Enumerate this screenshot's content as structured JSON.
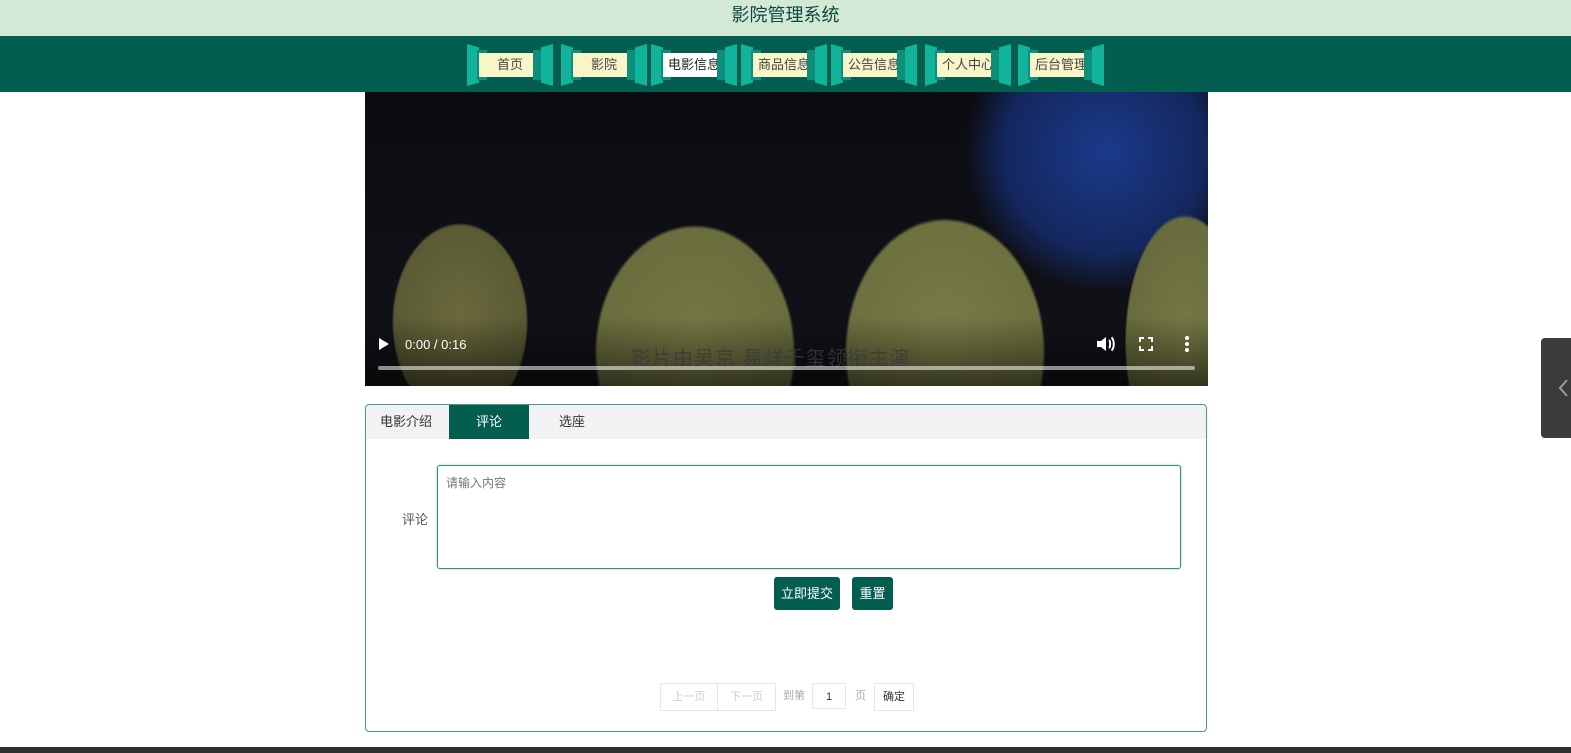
{
  "header": {
    "title": "影院管理系统"
  },
  "nav": {
    "items": [
      {
        "label": "首页",
        "active": false
      },
      {
        "label": "影院",
        "active": false
      },
      {
        "label": "电影信息",
        "active": true
      },
      {
        "label": "商品信息",
        "active": false
      },
      {
        "label": "公告信息",
        "active": false
      },
      {
        "label": "个人中心",
        "active": false
      },
      {
        "label": "后台管理",
        "active": false
      }
    ]
  },
  "video": {
    "time": "0:00 / 0:16",
    "subtitle": "影片由吴京 易烊千玺领衔主演",
    "progress": 0
  },
  "tabs": [
    {
      "label": "电影介绍",
      "active": false
    },
    {
      "label": "评论",
      "active": true
    },
    {
      "label": "选座",
      "active": false
    }
  ],
  "comment": {
    "label": "评论",
    "placeholder": "请输入内容",
    "submit_label": "立即提交",
    "reset_label": "重置"
  },
  "pagination": {
    "prev_label": "上一页",
    "next_label": "下一页",
    "goto_prefix": "到第",
    "page_value": "1",
    "page_suffix": "页",
    "confirm_label": "确定"
  },
  "colors": {
    "primary": "#045e50",
    "title_bar": "#d3e9d6",
    "nav_label_bg": "#f8f6c9",
    "nav_cap": "#11b39a"
  }
}
